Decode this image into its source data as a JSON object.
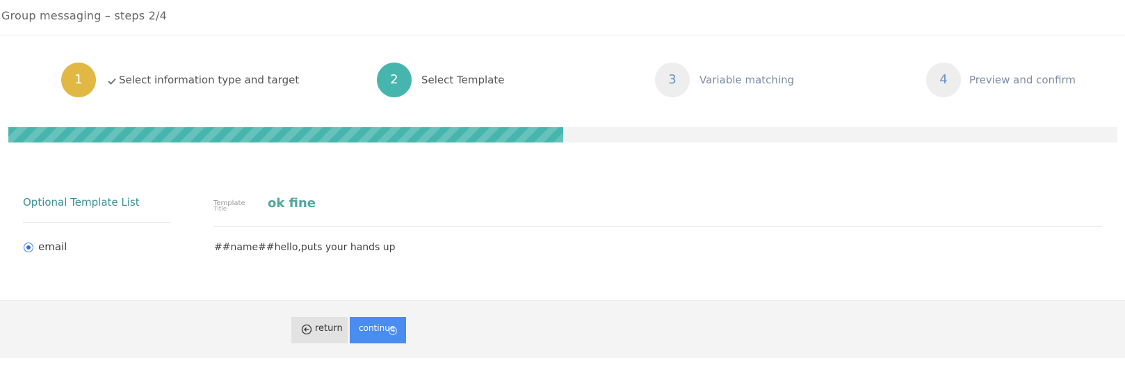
{
  "header": {
    "title": "Group messaging – steps 2/4"
  },
  "steps": [
    {
      "number": "1",
      "label": "Select information type and target",
      "state": "done",
      "color": "#e2b845"
    },
    {
      "number": "2",
      "label": "Select Template",
      "state": "active",
      "color": "#46b5ad"
    },
    {
      "number": "3",
      "label": "Variable matching",
      "state": "pending",
      "color": "#eeeeee"
    },
    {
      "number": "4",
      "label": "Preview and confirm",
      "state": "pending",
      "color": "#eeeeee"
    }
  ],
  "progress": {
    "percent": 50,
    "color": "#46b5ad"
  },
  "template_list": {
    "heading": "Optional Template List",
    "options": [
      {
        "label": "email",
        "selected": true
      }
    ]
  },
  "template": {
    "tag_line1": "Template",
    "tag_line2": "Title",
    "title": "ok fine",
    "body": "##name##hello,puts your hands up"
  },
  "actions": {
    "return_label": "return",
    "continue_label": "continue",
    "return_icon": "arrow-left-circle-icon",
    "continue_accent": "#4a8cf0"
  }
}
